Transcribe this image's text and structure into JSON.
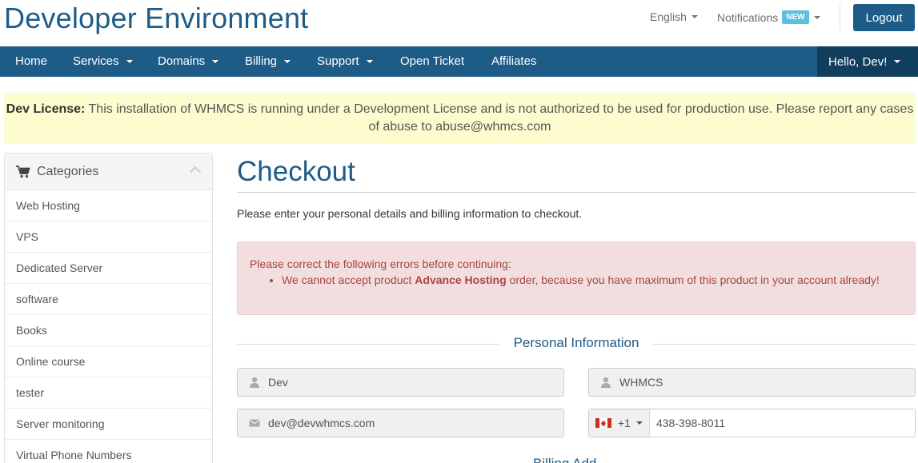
{
  "header": {
    "brand": "Developer Environment",
    "language": "English",
    "notifications": "Notifications",
    "notifications_badge": "NEW",
    "logout": "Logout"
  },
  "nav": {
    "items": [
      "Home",
      "Services",
      "Domains",
      "Billing",
      "Support",
      "Open Ticket",
      "Affiliates"
    ],
    "user_menu": "Hello, Dev!"
  },
  "license": {
    "label": "Dev License:",
    "text": "This installation of WHMCS is running under a Development License and is not authorized to be used for production use. Please report any cases of abuse to abuse@whmcs.com"
  },
  "sidebar": {
    "title": "Categories",
    "items": [
      "Web Hosting",
      "VPS",
      "Dedicated Server",
      "software",
      "Books",
      "Online course",
      "tester",
      "Server monitoring",
      "Virtual Phone Numbers"
    ]
  },
  "main": {
    "title": "Checkout",
    "intro": "Please enter your personal details and billing information to checkout.",
    "error": {
      "heading": "Please correct the following errors before continuing:",
      "message_pre": "We cannot accept product ",
      "message_product": "Advance Hosting",
      "message_post": " order, because you have maximum of this product in your account already!"
    },
    "personal_section": "Personal Information",
    "first_name": "Dev",
    "last_name": "WHMCS",
    "email": "dev@devwhmcs.com",
    "phone_code": "+1",
    "phone_number": "438-398-8011",
    "next_section_partial": "Billing Add"
  },
  "colors": {
    "brand": "#1e5c88",
    "nav_active": "#123e5e",
    "license_bg": "#fdfcce",
    "error_bg": "#f2dede",
    "error_text": "#a94442",
    "badge": "#5bc0de"
  }
}
